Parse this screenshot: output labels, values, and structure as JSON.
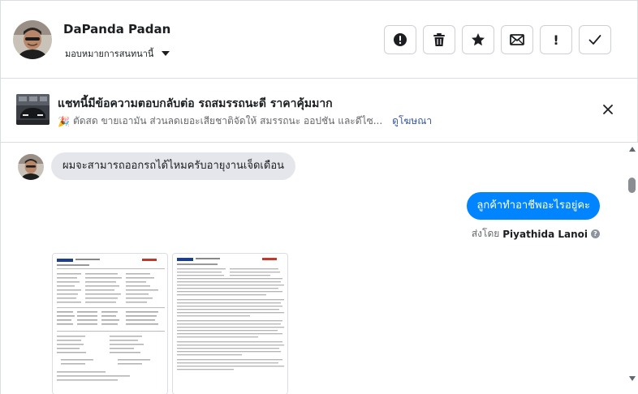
{
  "header": {
    "user_name": "DaPanda Padan",
    "assign_label": "มอบหมายการสนทนานี้",
    "actions": [
      {
        "name": "spam-button",
        "icon": "exclamation-circle-icon"
      },
      {
        "name": "delete-button",
        "icon": "trash-icon"
      },
      {
        "name": "star-button",
        "icon": "star-icon"
      },
      {
        "name": "mark-unread-button",
        "icon": "envelope-icon"
      },
      {
        "name": "follow-up-button",
        "icon": "exclamation-icon",
        "label": "!"
      },
      {
        "name": "done-button",
        "icon": "checkmark-icon"
      }
    ]
  },
  "ad": {
    "title": "แชทนี้มีข้อความตอบกลับต่อ รถสมรรถนะดี ราคาคุ้มมาก",
    "emoji": "🎉",
    "subtitle": "ตัดสด ขายเอามัน ส่วนลดเยอะเสียชาติจัดให้ สมรรถนะ ออปชัน และดีไซ...",
    "link": "ดูโฆษณา"
  },
  "conversation": {
    "incoming_message": "ผมจะสามารถออกรถได้ไหมครับอายุงานเจ็ดเดือน",
    "outgoing_message": "ลูกค้าทำอาชีพอะไรอยู่คะ",
    "sent_by_prefix": "ส่งโดย",
    "sent_by_name": "Piyathida Lanoi",
    "help_glyph": "?"
  },
  "colors": {
    "accent": "#0084ff",
    "bubble_in": "#e4e6eb",
    "border": "#dadde1"
  }
}
